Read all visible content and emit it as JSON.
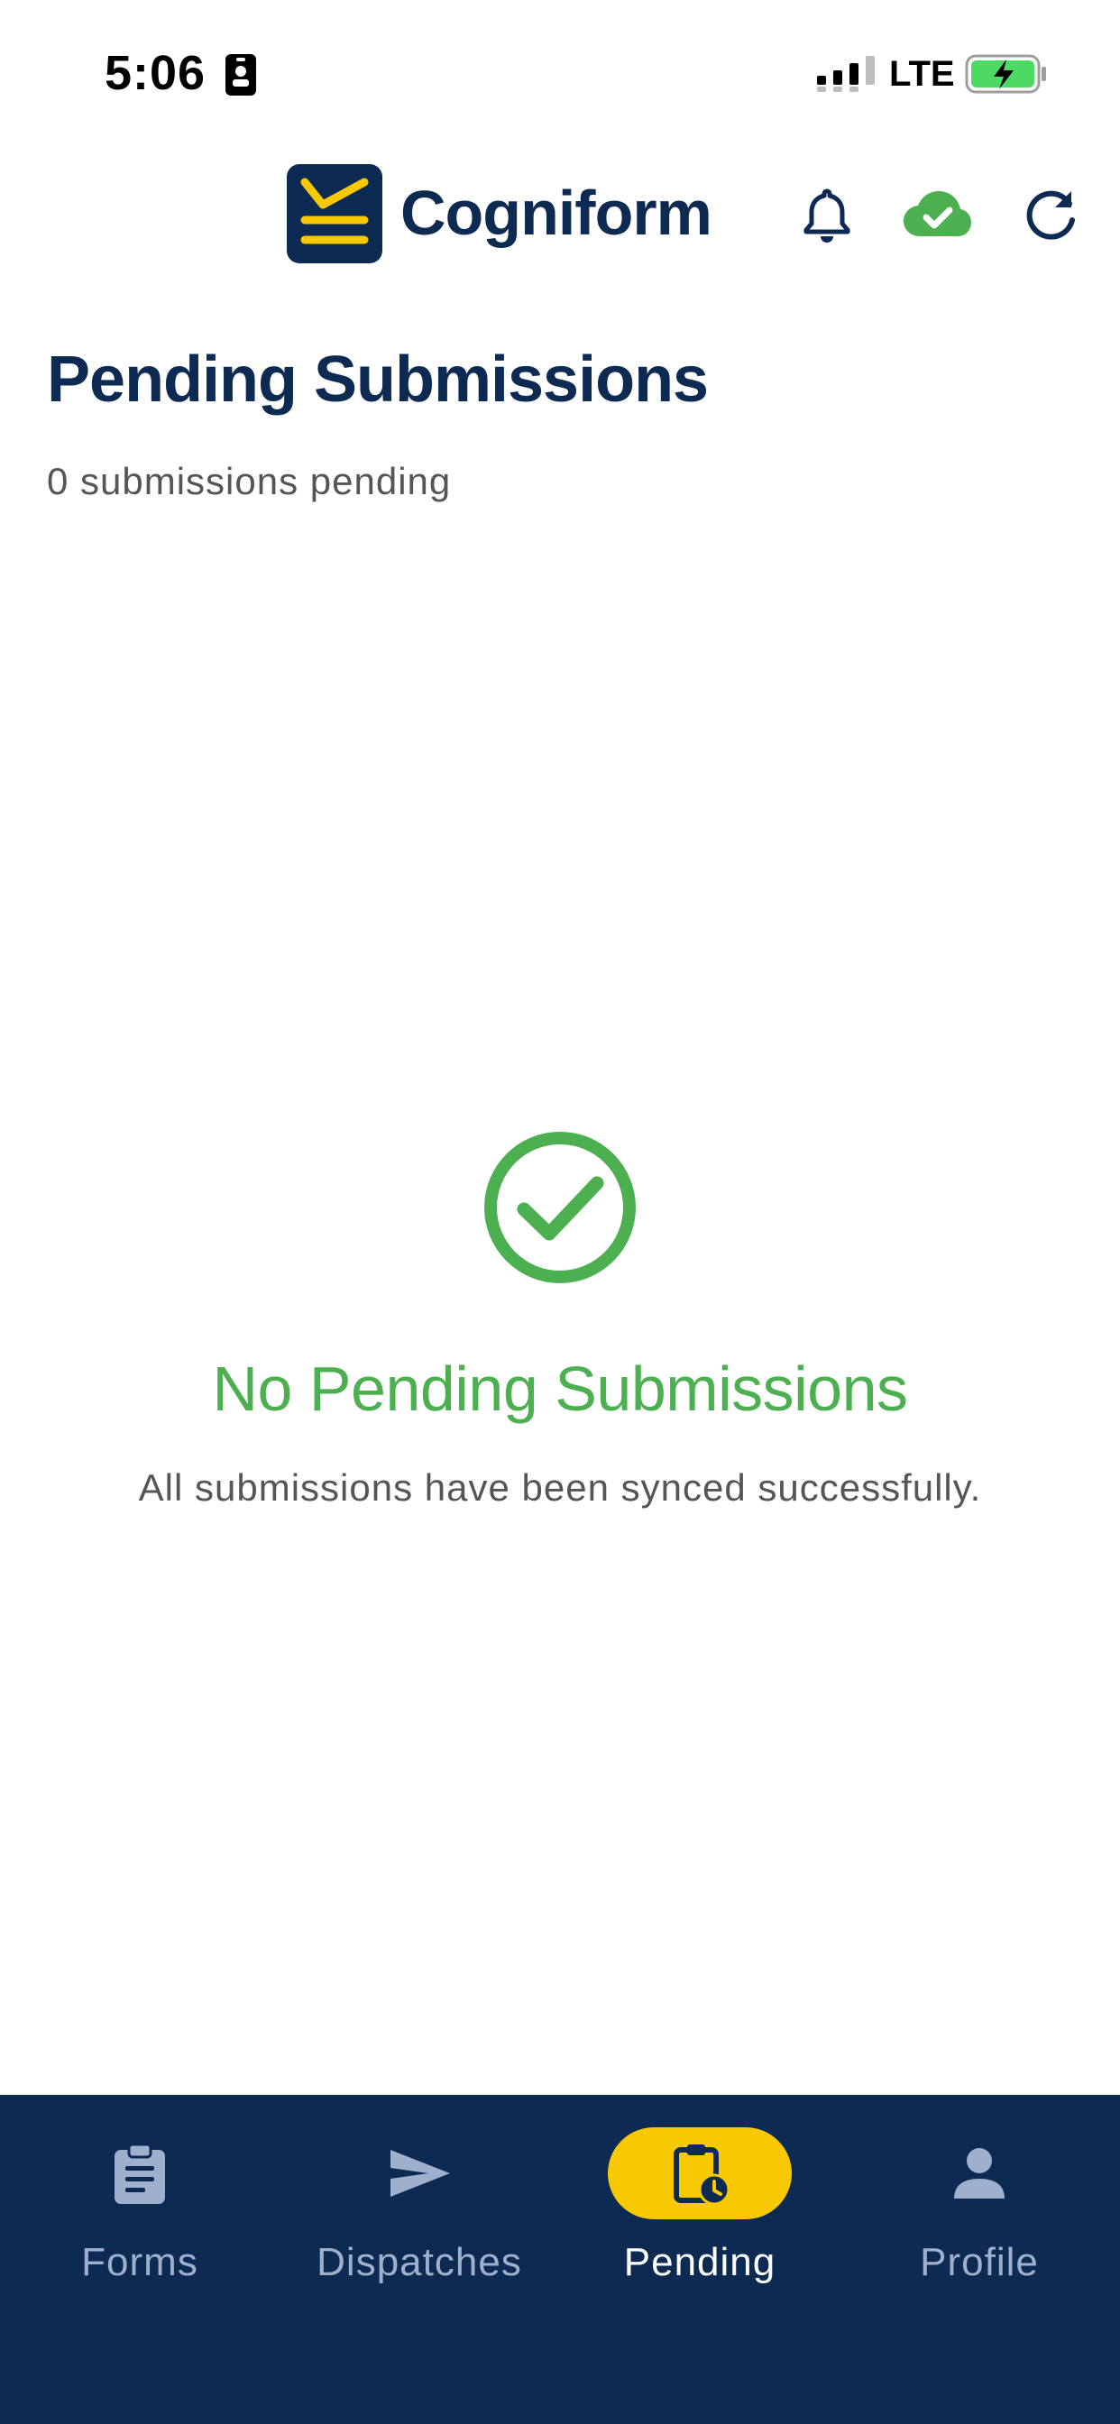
{
  "status_bar": {
    "time": "5:06",
    "network": "LTE"
  },
  "header": {
    "brand": "Cogniform",
    "icons": [
      "bell-icon",
      "cloud-check-icon",
      "refresh-icon"
    ]
  },
  "page": {
    "title": "Pending Submissions",
    "subtitle": "0 submissions pending"
  },
  "empty_state": {
    "icon": "check-circle-icon",
    "title": "No Pending Submissions",
    "message": "All submissions have been synced successfully."
  },
  "bottom_nav": {
    "items": [
      {
        "label": "Forms",
        "icon": "clipboard-icon",
        "active": false
      },
      {
        "label": "Dispatches",
        "icon": "send-icon",
        "active": false
      },
      {
        "label": "Pending",
        "icon": "clipboard-clock-icon",
        "active": true
      },
      {
        "label": "Profile",
        "icon": "person-icon",
        "active": false
      }
    ]
  },
  "colors": {
    "navy": "#0d2a52",
    "accent_yellow": "#f8c900",
    "success_green": "#4caf50",
    "nav_inactive": "#9eb0cc"
  }
}
